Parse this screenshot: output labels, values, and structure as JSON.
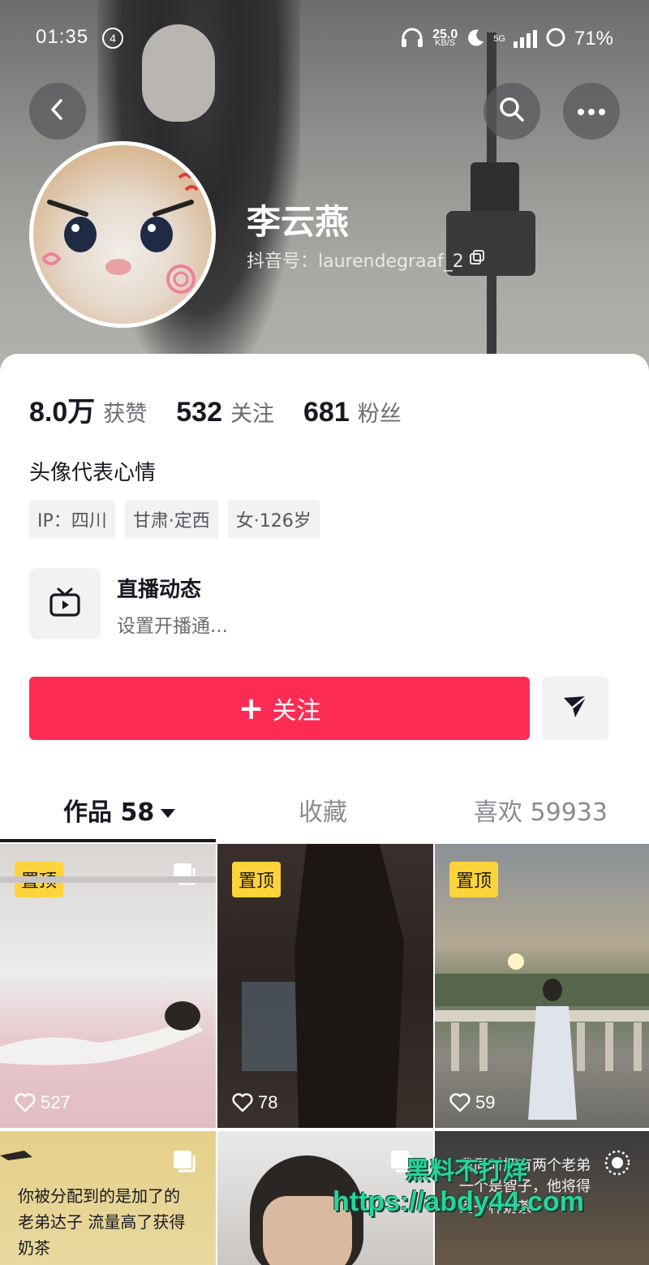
{
  "status_bar": {
    "time": "01:35",
    "notification_count": "4",
    "net_speed_value": "25.0",
    "net_speed_unit": "KB/S",
    "network": "5G",
    "battery": "71%"
  },
  "profile": {
    "name": "李云燕",
    "id_label": "抖音号：laurendegraaf_2"
  },
  "stats": [
    {
      "value": "8.0万",
      "label": "获赞"
    },
    {
      "value": "532",
      "label": "关注"
    },
    {
      "value": "681",
      "label": "粉丝"
    }
  ],
  "bio": "头像代表心情",
  "tags": [
    "IP：四川",
    "甘肃·定西",
    "女·126岁"
  ],
  "live": {
    "title": "直播动态",
    "subtitle": "设置开播通..."
  },
  "actions": {
    "follow_plus": "+",
    "follow_label": "关注"
  },
  "tabs": {
    "works": "作品 58",
    "collect": "收藏",
    "likes": "喜欢 59933"
  },
  "videos": [
    {
      "pinned": "置顶",
      "likes": "527"
    },
    {
      "pinned": "置顶",
      "likes": "78"
    },
    {
      "pinned": "置顶",
      "likes": "59"
    },
    {
      "caption_line1": "你被分配到的是加了的",
      "caption_line2": "老弟达子 流量高了获得",
      "caption_line3": "奶茶"
    },
    {},
    {
      "caption_line1": "我同时拥有两个老弟",
      "caption_line2": "一个是智子，他将得",
      "caption_line3": "到一杯奶茶"
    }
  ],
  "watermark": {
    "line1": "黑料不打烊",
    "line2": "https://abdy44.com"
  },
  "colors": {
    "accent": "#fe2c55",
    "pin_badge": "#ffd43b",
    "watermark": "#29d39d"
  }
}
